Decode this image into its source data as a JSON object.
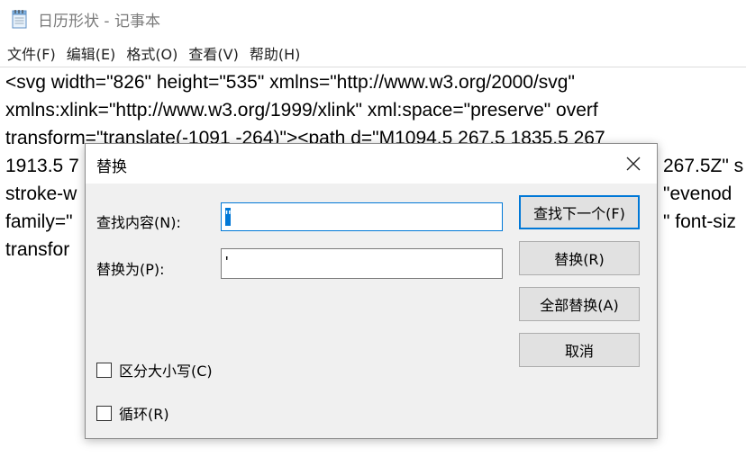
{
  "window": {
    "title": "日历形状 - 记事本"
  },
  "menu": {
    "items": [
      {
        "label": "文件(F)"
      },
      {
        "label": "编辑(E)"
      },
      {
        "label": "格式(O)"
      },
      {
        "label": "查看(V)"
      },
      {
        "label": "帮助(H)"
      }
    ]
  },
  "editor": {
    "lines": [
      "<svg width=\"826\" height=\"535\" xmlns=\"http://www.w3.org/2000/svg\"",
      "xmlns:xlink=\"http://www.w3.org/1999/xlink\" xml:space=\"preserve\" overf",
      "transform=\"translate(-1091 -264)\"><path d=\"M1094.5 267.5 1835.5 267",
      "1913.5 7",
      "stroke-w",
      "family=\"",
      "transfor"
    ],
    "line_fragments_right": [
      {
        "line": 3,
        "text": "267.5Z\" s"
      },
      {
        "line": 4,
        "text": "\"evenod"
      },
      {
        "line": 5,
        "text": "\" font-siz"
      }
    ]
  },
  "dialog": {
    "title": "替换",
    "find_label": "查找内容(N):",
    "find_value": "\"",
    "replace_label": "替换为(P):",
    "replace_value": "'",
    "buttons": {
      "find_next": "查找下一个(F)",
      "replace": "替换(R)",
      "replace_all": "全部替换(A)",
      "cancel": "取消"
    },
    "options": {
      "match_case": {
        "label": "区分大小写(C)",
        "checked": false
      },
      "wrap": {
        "label": "循环(R)",
        "checked": false
      }
    }
  },
  "colors": {
    "accent": "#0078d7",
    "dialog_bg": "#f0f0f0",
    "button_bg": "#e1e1e1"
  }
}
